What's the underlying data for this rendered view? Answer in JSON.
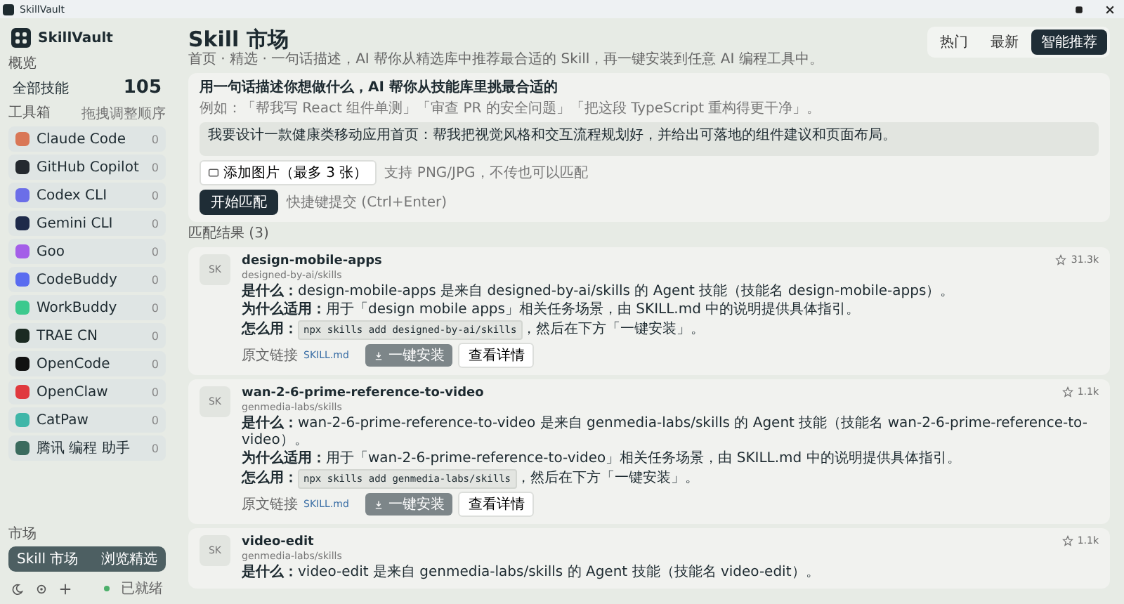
{
  "window": {
    "title": "SkillVault"
  },
  "sidebar": {
    "brand": "SkillVault",
    "overview_label": "概览",
    "all_skills": {
      "label": "全部技能",
      "count": "105"
    },
    "tools_label": "工具箱",
    "tools_hint": "拖拽调整顺序",
    "tools": [
      {
        "name": "Claude Code",
        "count": "0",
        "color": "#d97757"
      },
      {
        "name": "GitHub Copilot",
        "count": "0",
        "color": "#24292f"
      },
      {
        "name": "Codex CLI",
        "count": "0",
        "color": "#6b6ee8"
      },
      {
        "name": "Gemini CLI",
        "count": "0",
        "color": "#1e2a4a"
      },
      {
        "name": "Goo",
        "count": "0",
        "color": "#a45ee8"
      },
      {
        "name": "CodeBuddy",
        "count": "0",
        "color": "#5a6cf0"
      },
      {
        "name": "WorkBuddy",
        "count": "0",
        "color": "#3cc98e"
      },
      {
        "name": "TRAE CN",
        "count": "0",
        "color": "#1b2a22"
      },
      {
        "name": "OpenCode",
        "count": "0",
        "color": "#111111"
      },
      {
        "name": "OpenClaw",
        "count": "0",
        "color": "#e0393e"
      },
      {
        "name": "CatPaw",
        "count": "0",
        "color": "#3fb6a8"
      },
      {
        "name": "腾讯 编程 助手",
        "count": "0",
        "color": "#3b6b5e"
      }
    ],
    "market_label": "市场",
    "market_item": {
      "label": "Skill 市场",
      "badge": "浏览精选",
      "selected": true
    },
    "status": "已就绪"
  },
  "header": {
    "title": "Skill 市场",
    "subtitle": "首页 · 精选 · 一句话描述，AI 帮你从精选库中推荐最合适的 Skill，再一键安装到任意 AI 编程工具中。",
    "tabs": [
      {
        "label": "热门",
        "selected": false
      },
      {
        "label": "最新",
        "selected": false
      },
      {
        "label": "智能推荐",
        "selected": true
      }
    ]
  },
  "matcher": {
    "title": "用一句话描述你想做什么，AI 帮你从技能库里挑最合适的",
    "example": "例如：「帮我写 React 组件单测」「审查 PR 的安全问题」「把这段 TypeScript 重构得更干净」。",
    "value": "我要设计一款健康类移动应用首页：帮我把视觉风格和交互流程规划好，并给出可落地的组件建议和页面布局。",
    "attach_button": "添加图片（最多 3 张）",
    "attach_hint": "支持 PNG/JPG，不传也可以匹配",
    "submit": "开始匹配",
    "submit_hint": "快捷键提交 (Ctrl+Enter)"
  },
  "results": {
    "label": "匹配结果 (3)",
    "skills": [
      {
        "icon_text": "SK",
        "name": "design-mobile-apps",
        "source": "designed-by-ai/skills",
        "stars": "31.3k",
        "lines": [
          "**是什么：**design-mobile-apps 是来自 designed-by-ai/skills 的 Agent 技能（技能名 design-mobile-apps）。",
          "**为什么适用：**用于「design mobile apps」相关任务场景，由 SKILL.md 中的说明提供具体指引。"
        ],
        "how": {
          "label": "怎么用：",
          "command": "npx skills add designed-by-ai/skills",
          "note": "，然后在下方「一键安装」。"
        },
        "link": {
          "label": "原文链接",
          "text": "SKILL.md"
        },
        "install": "一键安装",
        "details": "查看详情"
      },
      {
        "icon_text": "SK",
        "name": "wan-2-6-prime-reference-to-video",
        "source": "genmedia-labs/skills",
        "stars": "1.1k",
        "lines": [
          "**是什么：**wan-2-6-prime-reference-to-video 是来自 genmedia-labs/skills 的 Agent 技能（技能名 wan-2-6-prime-reference-to-video）。",
          "**为什么适用：**用于「wan-2-6-prime-reference-to-video」相关任务场景，由 SKILL.md 中的说明提供具体指引。"
        ],
        "how": {
          "label": "怎么用：",
          "command": "npx skills add genmedia-labs/skills",
          "note": "，然后在下方「一键安装」。"
        },
        "link": {
          "label": "原文链接",
          "text": "SKILL.md"
        },
        "install": "一键安装",
        "details": "查看详情"
      },
      {
        "icon_text": "SK",
        "name": "video-edit",
        "source": "genmedia-labs/skills",
        "stars": "1.1k",
        "lines": [
          "**是什么：**video-edit 是来自 genmedia-labs/skills 的 Agent 技能（技能名 video-edit）。"
        ]
      }
    ]
  }
}
